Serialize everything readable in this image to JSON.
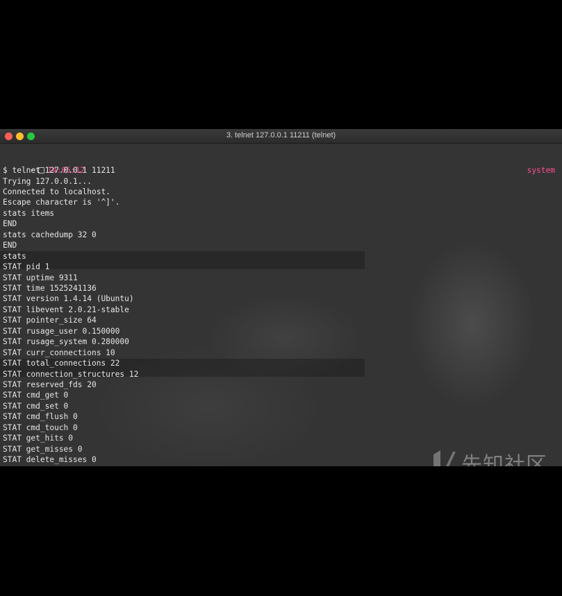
{
  "window": {
    "title": "3. telnet 127.0.0.1 11211 (telnet)"
  },
  "prompt": {
    "tilde": "~",
    "time": "14:05:12",
    "right_label": "system",
    "icon": "drive-icon"
  },
  "colors": {
    "prompt_time": "#ff4f93",
    "prompt_tilde": "#f0c674",
    "text": "#e6e6e6",
    "background": "#343434"
  },
  "terminal_lines": [
    "$ telnet 127.0.0.1 11211",
    "Trying 127.0.0.1...",
    "Connected to localhost.",
    "Escape character is '^]'.",
    "stats items",
    "END",
    "stats cachedump 32 0",
    "END",
    "stats",
    "STAT pid 1",
    "STAT uptime 9311",
    "STAT time 1525241136",
    "STAT version 1.4.14 (Ubuntu)",
    "STAT libevent 2.0.21-stable",
    "STAT pointer_size 64",
    "STAT rusage_user 0.150000",
    "STAT rusage_system 0.280000",
    "STAT curr_connections 10",
    "STAT total_connections 22",
    "STAT connection_structures 12",
    "STAT reserved_fds 20",
    "STAT cmd_get 0",
    "STAT cmd_set 0",
    "STAT cmd_flush 0",
    "STAT cmd_touch 0",
    "STAT get_hits 0",
    "STAT get_misses 0",
    "STAT delete_misses 0"
  ],
  "watermark": {
    "text": "先知社区"
  }
}
